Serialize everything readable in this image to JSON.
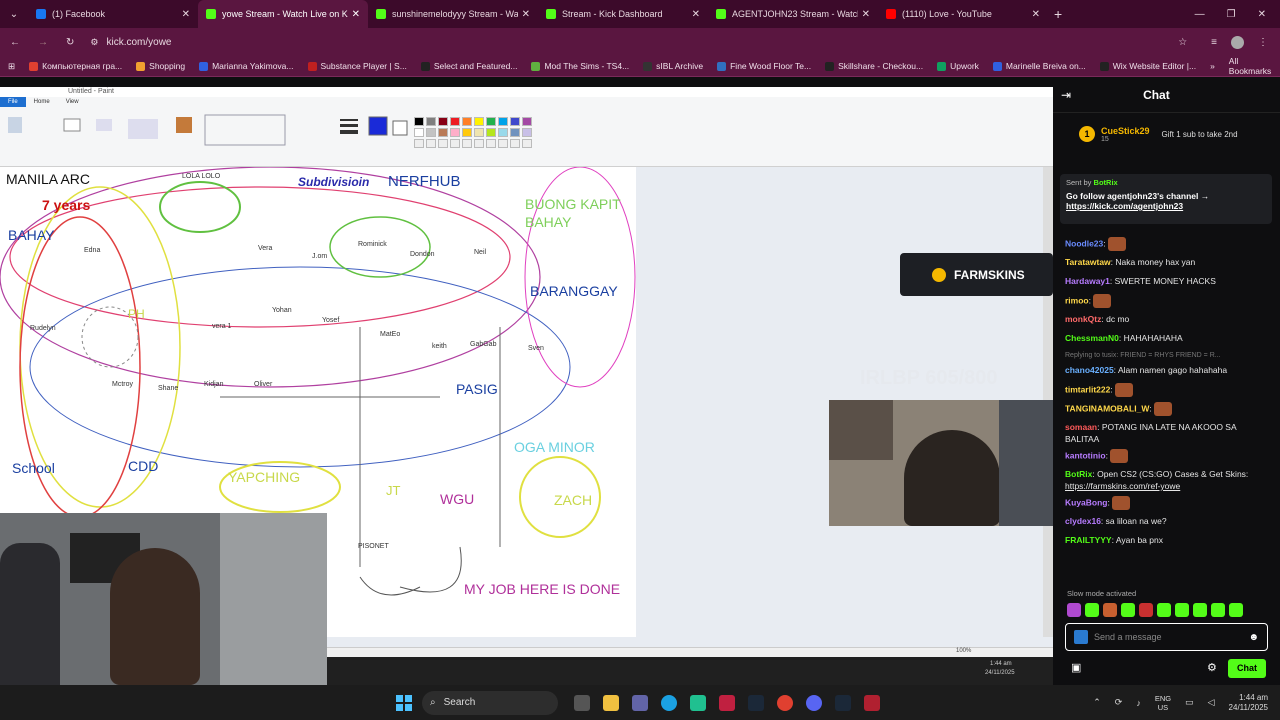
{
  "browser": {
    "tabs": [
      {
        "title": "(1) Facebook",
        "color": "#1877f2"
      },
      {
        "title": "yowe Stream - Watch Live on K",
        "color": "#53fc18"
      },
      {
        "title": "sunshinemelodyyy Stream - Wa",
        "color": "#53fc18"
      },
      {
        "title": "Stream - Kick Dashboard",
        "color": "#53fc18"
      },
      {
        "title": "AGENTJOHN23 Stream - Watch",
        "color": "#53fc18"
      },
      {
        "title": "(1110) Love - YouTube",
        "color": "#ff0000"
      }
    ],
    "url": "kick.com/yowe",
    "bookmarks": [
      "Компьютерная гра...",
      "Shopping",
      "Marianna Yakimova...",
      "Substance Player | S...",
      "Select and Featured...",
      "Mod The Sims - TS4...",
      "sIBL Archive",
      "Fine Wood Floor Te...",
      "Skillshare - Checkou...",
      "Upwork",
      "Marinelle Breiva on...",
      "Wix Website Editor |..."
    ],
    "all_bookmarks": "All Bookmarks"
  },
  "paint": {
    "title": "Untitled - Paint",
    "menu": [
      "File",
      "Home",
      "View"
    ],
    "zoom": "100%",
    "time": "1:44 am",
    "date": "24/11/2025"
  },
  "drawing": {
    "labels": [
      {
        "text": "MANILA ARC",
        "color": "#111111"
      },
      {
        "text": "7 years",
        "color": "#cc1111"
      },
      {
        "text": "BAHAY",
        "color": "#1a3fa0"
      },
      {
        "text": "Subdivisioin",
        "color": "#2a2aaa"
      },
      {
        "text": "NERFHUB",
        "color": "#1a3fa0"
      },
      {
        "text": "BUONG KAPIT BAHAY",
        "color": "#7ecf5a"
      },
      {
        "text": "BARANGGAY",
        "color": "#1a3fa0"
      },
      {
        "text": "PASIG",
        "color": "#1a3fa0"
      },
      {
        "text": "OGA MINOR",
        "color": "#6ad0e0"
      },
      {
        "text": "School",
        "color": "#1a3fa0"
      },
      {
        "text": "CDD",
        "color": "#1a3fa0"
      },
      {
        "text": "YAPCHING",
        "color": "#c8d84a"
      },
      {
        "text": "WGU",
        "color": "#b0309a"
      },
      {
        "text": "ZACH",
        "color": "#c8d84a"
      },
      {
        "text": "MY JOB HERE IS DONE",
        "color": "#b0309a"
      }
    ],
    "names": [
      "LOLA LOLO",
      "Vera",
      "J.om",
      "Rominick",
      "Dondon",
      "Neil",
      "Yohan",
      "Yosef",
      "MatEo",
      "keith",
      "GabGab",
      "Sven",
      "Mctroy",
      "Shane",
      "Kidjan",
      "Oliver",
      "Rudelyn",
      "vera 1",
      "PH",
      "Edna",
      "JT",
      "PISONET"
    ]
  },
  "overlay": {
    "farmskins": "FARMSKINS",
    "ghost": "IRLBP 605/800"
  },
  "chat": {
    "title": "Chat",
    "top_user": "CueStick29",
    "top_count": "15",
    "top_note": "Gift 1 sub to take 2nd",
    "pinned_by": "Sent by",
    "pinned_user": "BotRix",
    "pinned_text": "Go follow agentjohn23's channel →",
    "pinned_link": "https://kick.com/agentjohn23",
    "messages": [
      {
        "user": "Noodle23",
        "text": "",
        "color": "#6a8cff"
      },
      {
        "user": "Taratawtaw",
        "text": "Naka money hax yan",
        "color": "#ffd84a"
      },
      {
        "user": "Hardaway1",
        "text": "SWERTE MONEY HACKS",
        "color": "#b77cff"
      },
      {
        "user": "rimoo",
        "text": "",
        "color": "#ffd84a"
      },
      {
        "user": "monkQtz",
        "text": "dc mo",
        "color": "#ff6a6a"
      },
      {
        "user": "ChessmanN0",
        "text": "HAHAHAHAHA",
        "color": "#53fc18"
      },
      {
        "user": "chano42025",
        "text": "Alam namen gago hahahaha",
        "color": "#6ab0ff",
        "reply": "Replying to tusix: FRIEND = RHYS FRIEND = R..."
      },
      {
        "user": "timtarlit222",
        "text": "",
        "color": "#ffd84a"
      },
      {
        "user": "TANGINAMOBALI_W",
        "text": "",
        "color": "#ffd84a"
      },
      {
        "user": "somaan",
        "text": "POTANG INA LATE NA AKOOO SA BALITAA",
        "color": "#ff5a5a"
      },
      {
        "user": "kantotinio",
        "text": "",
        "color": "#b77cff"
      },
      {
        "user": "BotRix",
        "text": "Open CS2 (CS:GO) Cases & Get Skins: ",
        "link": "https://farmskins.com/ref-yowe",
        "color": "#53fc18"
      },
      {
        "user": "KuyaBong",
        "text": "",
        "color": "#b77cff"
      },
      {
        "user": "clydex16",
        "text": "sa liloan na we?",
        "color": "#b77cff"
      },
      {
        "user": "FRAILTYYY",
        "text": "Ayan ba pnx",
        "color": "#53fc18"
      }
    ],
    "slow_mode": "Slow mode activated",
    "placeholder": "Send a message",
    "send": "Chat"
  },
  "taskbar": {
    "search": "Search",
    "lang": "ENG",
    "region": "US",
    "time": "1:44 am",
    "date": "24/11/2025"
  }
}
